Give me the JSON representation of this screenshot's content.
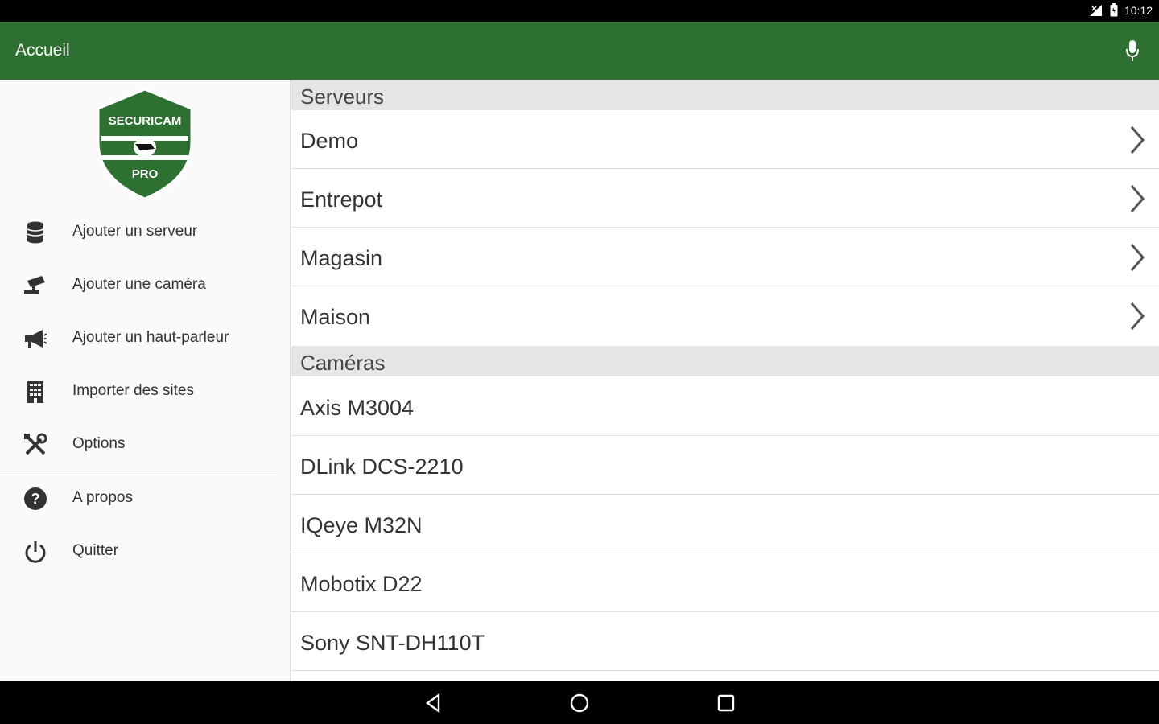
{
  "status": {
    "time": "10:12"
  },
  "app_bar": {
    "title": "Accueil",
    "mic_icon": "microphone-icon"
  },
  "drawer": {
    "logo": {
      "top": "SECURICAM",
      "bottom": "PRO"
    },
    "items": [
      {
        "label": "Ajouter un serveur",
        "icon": "database-icon"
      },
      {
        "label": "Ajouter une caméra",
        "icon": "camera-icon"
      },
      {
        "label": "Ajouter un haut-parleur",
        "icon": "megaphone-icon"
      },
      {
        "label": "Importer des sites",
        "icon": "building-icon"
      },
      {
        "label": "Options",
        "icon": "tools-icon"
      },
      {
        "label": "A propos",
        "icon": "help-icon"
      },
      {
        "label": "Quitter",
        "icon": "power-icon"
      }
    ]
  },
  "servers": {
    "header": "Serveurs",
    "items": [
      "Demo",
      "Entrepot",
      "Magasin",
      "Maison"
    ]
  },
  "cameras": {
    "header": "Caméras",
    "items": [
      "Axis M3004",
      "DLink DCS-2210",
      "IQeye M32N",
      "Mobotix D22",
      "Sony SNT-DH110T"
    ]
  },
  "colors": {
    "accent": "#2e7032",
    "header_bg": "#e5e5e5"
  }
}
